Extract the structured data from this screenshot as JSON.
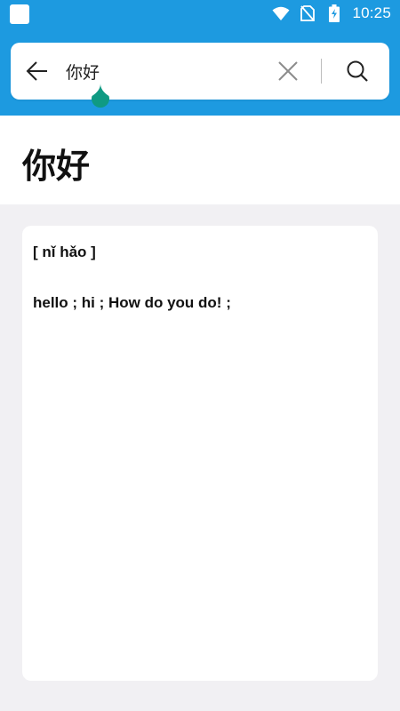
{
  "status_bar": {
    "time": "10:25",
    "icons": [
      "app-notification-icon",
      "wifi-icon",
      "no-sim-icon",
      "battery-charging-icon"
    ]
  },
  "search": {
    "query": "你好",
    "placeholder": "",
    "back_icon": "back-arrow-icon",
    "clear_icon": "close-icon",
    "search_icon": "search-icon"
  },
  "word": {
    "title": "你好"
  },
  "result": {
    "pinyin": "[ nǐ hǎo ]",
    "definition": "hello ; hi ; How do you do! ;"
  },
  "colors": {
    "primary": "#1d9ae0",
    "background": "#f1f0f3",
    "card": "#ffffff",
    "cursor_handle": "#0f9a83"
  }
}
